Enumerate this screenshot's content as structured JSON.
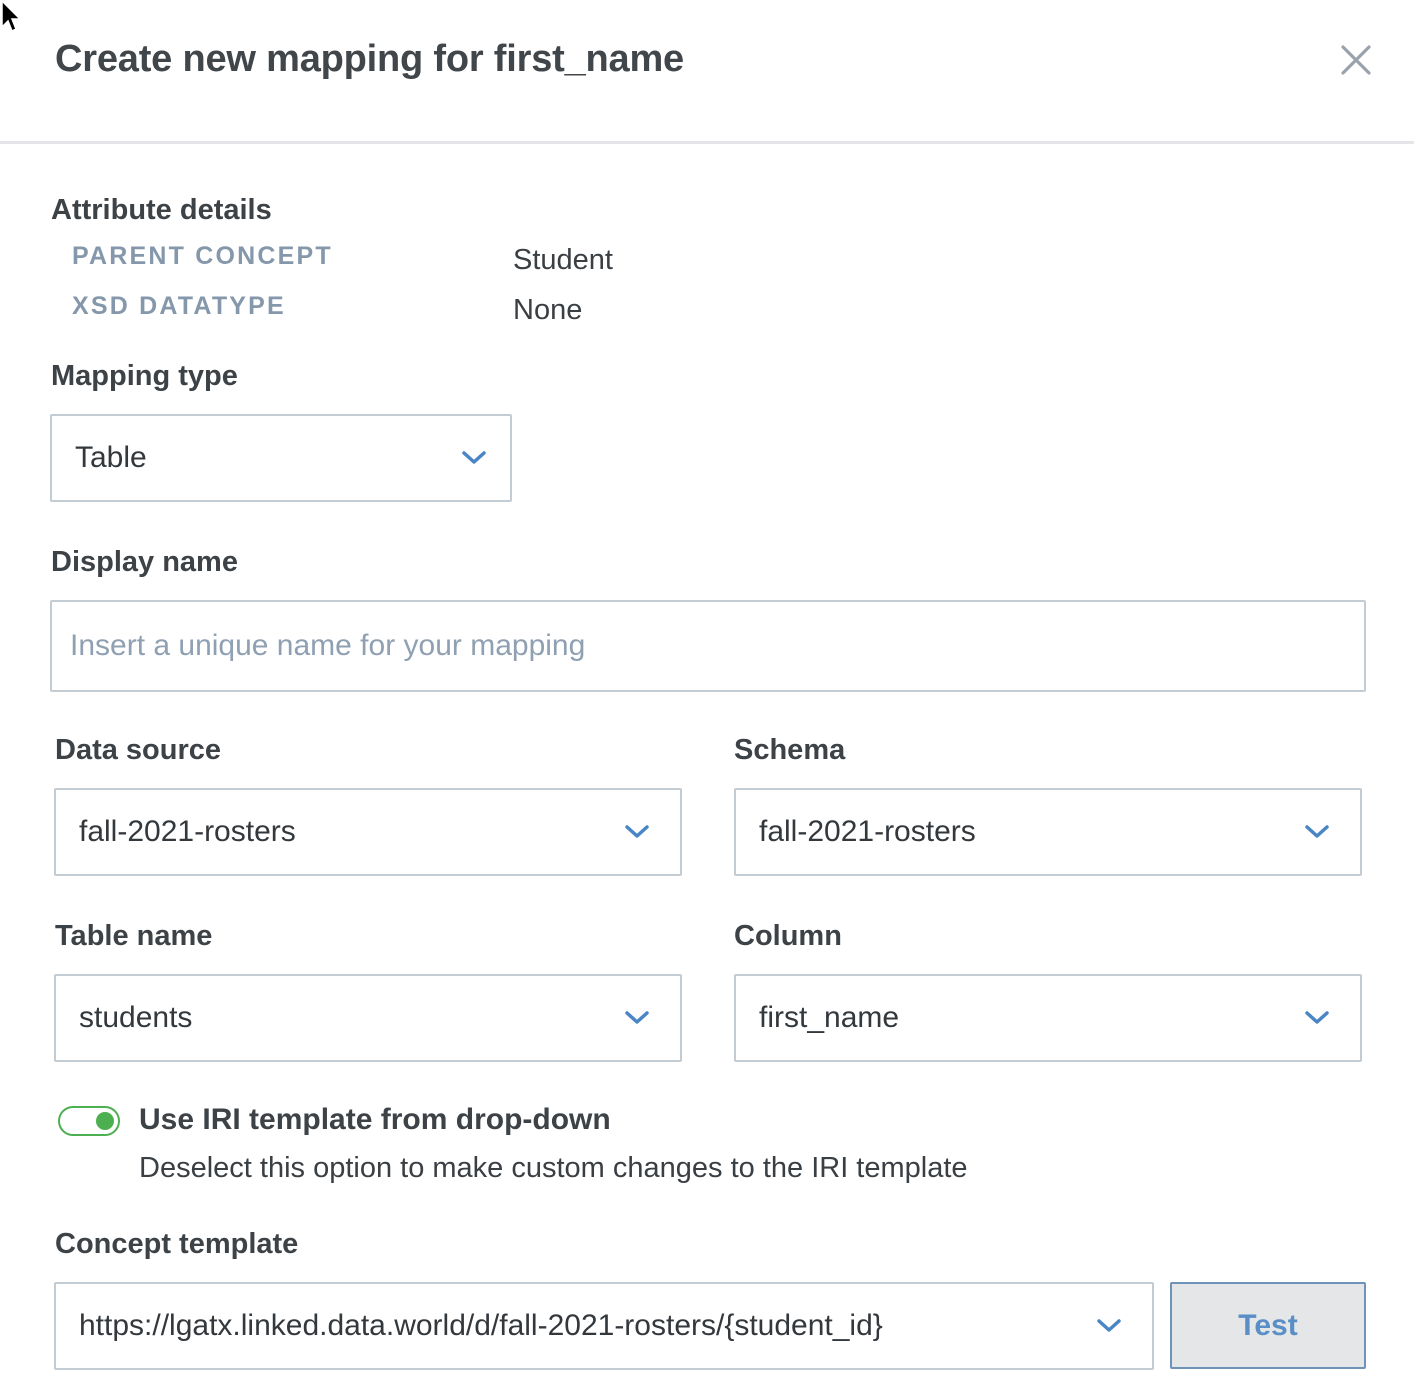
{
  "dialog": {
    "title": "Create new mapping for first_name",
    "close_icon": "close-icon"
  },
  "attribute_details": {
    "heading": "Attribute details",
    "rows": [
      {
        "key": "PARENT CONCEPT",
        "value": "Student"
      },
      {
        "key": "XSD DATATYPE",
        "value": "None"
      }
    ]
  },
  "mapping_type": {
    "label": "Mapping type",
    "value": "Table"
  },
  "display_name": {
    "label": "Display name",
    "value": "",
    "placeholder": "Insert a unique name for your mapping"
  },
  "data_source": {
    "label": "Data source",
    "value": "fall-2021-rosters"
  },
  "schema": {
    "label": "Schema",
    "value": "fall-2021-rosters"
  },
  "table_name": {
    "label": "Table name",
    "value": "students"
  },
  "column": {
    "label": "Column",
    "value": "first_name"
  },
  "iri_toggle": {
    "label": "Use IRI template from drop-down",
    "help": "Deselect this option to make custom changes to the IRI template",
    "enabled": true
  },
  "concept_template": {
    "label": "Concept template",
    "value": "https://lgatx.linked.data.world/d/fall-2021-rosters/{student_id}",
    "test_button": "Test"
  },
  "colors": {
    "toggle_on": "#4caf50",
    "chevron": "#4a86c5",
    "muted_label": "#8597ab",
    "button_text": "#5a8ec6"
  }
}
